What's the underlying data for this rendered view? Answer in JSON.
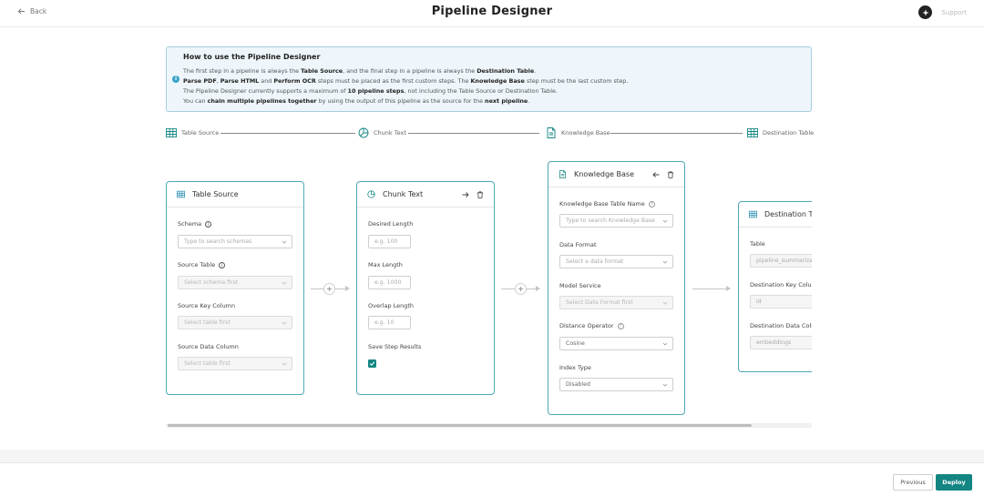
{
  "header": {
    "back_label": "Back",
    "title": "Pipeline Designer",
    "support_label": "Support"
  },
  "info": {
    "heading": "How to use the Pipeline Designer",
    "line1": {
      "t1": "The first step in a pipeline is always the ",
      "b1": "Table Source",
      "t2": ", and the final step in a pipeline is always the ",
      "b2": "Destination Table",
      "t3": "."
    },
    "line2": {
      "b1": "Parse PDF",
      "t1": ", ",
      "b2": "Parse HTML",
      "t2": " and ",
      "b3": "Perform OCR",
      "t3": " steps must be placed as the first custom steps. The ",
      "b4": "Knowledge Base",
      "t4": " step must be the last custom step."
    },
    "line3": {
      "t1": "The Pipeline Designer currently supports a maximum of ",
      "b1": "10 pipeline steps",
      "t2": ", not including the Table Source or Destination Table."
    },
    "line4": {
      "t1": "You can ",
      "b1": "chain multiple pipelines together",
      "t2": " by using the output of this pipeline as the source for the ",
      "b2": "next pipeline",
      "t3": "."
    }
  },
  "stepper": {
    "steps": [
      "Table Source",
      "Chunk Text",
      "Knowledge Base",
      "Destination Table"
    ]
  },
  "cards": {
    "table_source": {
      "title": "Table Source",
      "schema_label": "Schema",
      "schema_placeholder": "Type to search schemas",
      "source_table_label": "Source Table",
      "source_table_value": "Select schema first",
      "key_col_label": "Source Key Column",
      "key_col_value": "Select table first",
      "data_col_label": "Source Data Column",
      "data_col_value": "Select table first"
    },
    "chunk_text": {
      "title": "Chunk Text",
      "desired_length_label": "Desired Length",
      "desired_length_placeholder": "e.g. 100",
      "max_length_label": "Max Length",
      "max_length_placeholder": "e.g. 1000",
      "overlap_length_label": "Overlap Length",
      "overlap_length_placeholder": "e.g. 10",
      "save_results_label": "Save Step Results",
      "save_results_checked": true
    },
    "knowledge_base": {
      "title": "Knowledge Base",
      "table_name_label": "Knowledge Base Table Name",
      "table_name_placeholder": "Type to search Knowledge Base",
      "data_format_label": "Data Format",
      "data_format_placeholder": "Select a data format",
      "model_service_label": "Model Service",
      "model_service_value": "Select Data Format first",
      "distance_operator_label": "Distance Operator",
      "distance_operator_value": "Cosine",
      "index_type_label": "Index Type",
      "index_type_value": "Disabled"
    },
    "destination_table": {
      "title": "Destination Table",
      "table_label": "Table",
      "table_value": "pipeline_summarization",
      "key_col_label": "Destination Key Column",
      "key_col_value": "id",
      "data_col_label": "Destination Data Column",
      "data_col_value": "embeddings"
    }
  },
  "footer": {
    "previous_label": "Previous",
    "deploy_label": "Deploy"
  },
  "colors": {
    "accent": "#138582",
    "card_border": "#4ea8b9",
    "info_bg": "#eef6fb",
    "info_border": "#a6cde0"
  },
  "icons": {
    "back": "arrow-left-icon",
    "support": "sparkle-icon",
    "table": "table-grid-icon",
    "chunk": "pie-chart-icon",
    "knowledge": "document-icon",
    "move": "arrow-icon",
    "delete": "trash-icon",
    "add": "plus-icon",
    "dropdown": "chevron-down-icon",
    "help": "help-circle-icon",
    "info": "info-icon",
    "check": "check-icon"
  }
}
